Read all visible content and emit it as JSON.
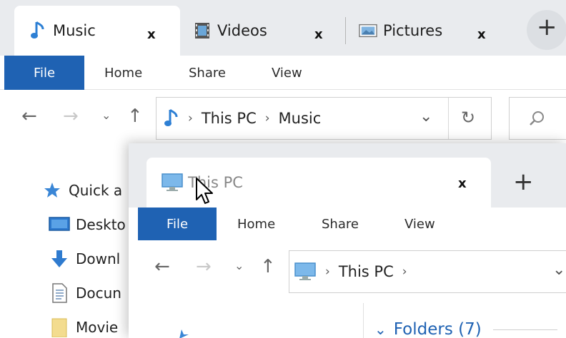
{
  "back_window": {
    "tabs": [
      {
        "label": "Music",
        "icon": "music-note-icon",
        "close": "x"
      },
      {
        "label": "Videos",
        "icon": "film-icon",
        "close": "x"
      },
      {
        "label": "Pictures",
        "icon": "picture-icon",
        "close": "x"
      }
    ],
    "new_tab": "+",
    "menu": {
      "file": "File",
      "home": "Home",
      "share": "Share",
      "view": "View"
    },
    "address": {
      "crumbs": [
        "This PC",
        "Music"
      ]
    },
    "sidebar": [
      "Quick a",
      "Deskto",
      "Downl",
      "Docun",
      "Movie"
    ]
  },
  "front_window": {
    "tab": {
      "label": "This PC",
      "close": "x"
    },
    "new_tab": "+",
    "menu": {
      "file": "File",
      "home": "Home",
      "share": "Share",
      "view": "View"
    },
    "address": {
      "crumbs": [
        "This PC"
      ]
    },
    "section": "Folders (7)"
  },
  "colors": {
    "accent": "#1f62b3",
    "tabstrip": "#e9ebee",
    "link_blue": "#1f62b3"
  }
}
